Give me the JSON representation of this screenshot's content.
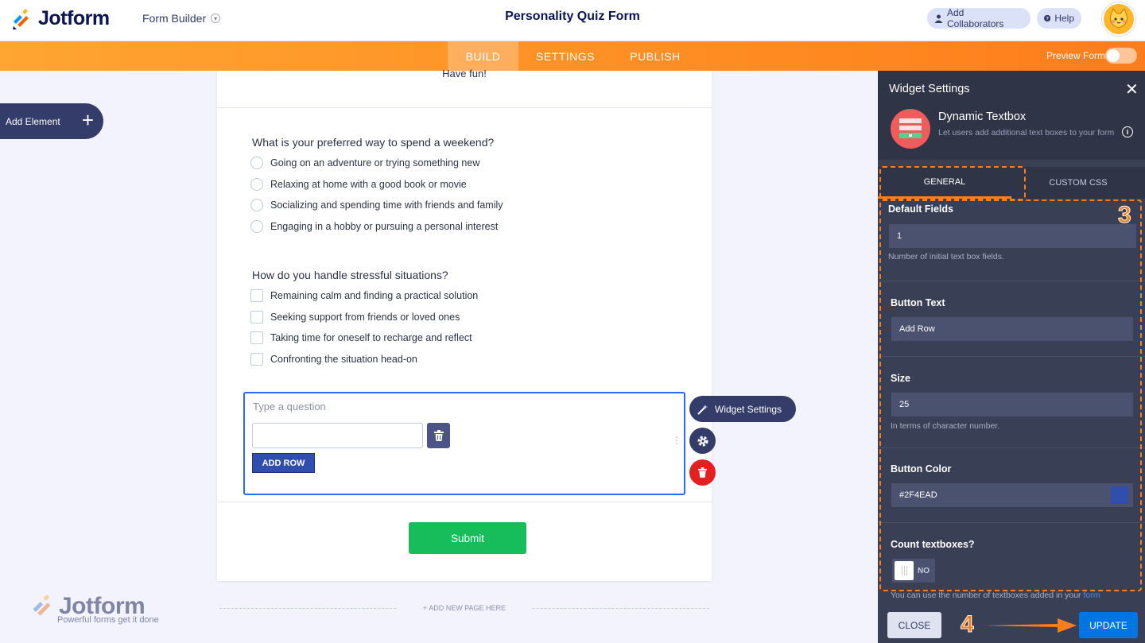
{
  "header": {
    "logo_text": "Jotform",
    "builder_label": "Form Builder",
    "form_title": "Personality Quiz Form",
    "add_collaborators": "Add Collaborators",
    "help": "Help"
  },
  "nav": {
    "tabs": [
      "BUILD",
      "SETTINGS",
      "PUBLISH"
    ],
    "active_tab": "BUILD",
    "preview_label": "Preview Form",
    "preview_on": false
  },
  "left": {
    "add_element": "Add Element"
  },
  "form": {
    "intro_tail": "Have fun!",
    "q1": {
      "title": "What is your preferred way to spend a weekend?",
      "options": [
        "Going on an adventure or trying something new",
        "Relaxing at home with a good book or movie",
        "Socializing and spending time with friends and family",
        "Engaging in a hobby or pursuing a personal interest"
      ]
    },
    "q2": {
      "title": "How do you handle stressful situations?",
      "options": [
        "Remaining calm and finding a practical solution",
        "Seeking support from friends or loved ones",
        "Taking time for oneself to recharge and reflect",
        "Confronting the situation head-on"
      ]
    },
    "widget": {
      "question_placeholder": "Type a question",
      "add_row": "ADD ROW"
    },
    "submit": "Submit",
    "add_new_page": "+ ADD NEW PAGE HERE"
  },
  "floating": {
    "widget_settings": "Widget Settings"
  },
  "watermark": {
    "title": "Jotform",
    "tagline": "Powerful forms get it done"
  },
  "panel": {
    "title": "Widget Settings",
    "widget_name": "Dynamic Textbox",
    "widget_desc": "Let users add additional text boxes to your form",
    "tabs": [
      "GENERAL",
      "CUSTOM CSS"
    ],
    "active_tab": "GENERAL",
    "fields": {
      "default_fields": {
        "label": "Default Fields",
        "value": "1",
        "help": "Number of initial text box fields."
      },
      "button_text": {
        "label": "Button Text",
        "value": "Add Row"
      },
      "size": {
        "label": "Size",
        "value": "25",
        "help": "In terms of character number."
      },
      "button_color": {
        "label": "Button Color",
        "value": "#2F4EAD"
      },
      "count_textboxes": {
        "label": "Count textboxes?",
        "value": "NO"
      }
    },
    "cut_help": "You can use the number of textboxes added in your",
    "cut_link": "form",
    "close": "CLOSE",
    "update": "UPDATE"
  },
  "annotations": {
    "step3": "3",
    "step4": "4"
  },
  "colors": {
    "accent_orange": "#ff7d1b",
    "widget_button": "#2f4ead",
    "submit_green": "#18bd5b",
    "update_blue": "#0075e3",
    "panel_bg": "#393f55"
  }
}
